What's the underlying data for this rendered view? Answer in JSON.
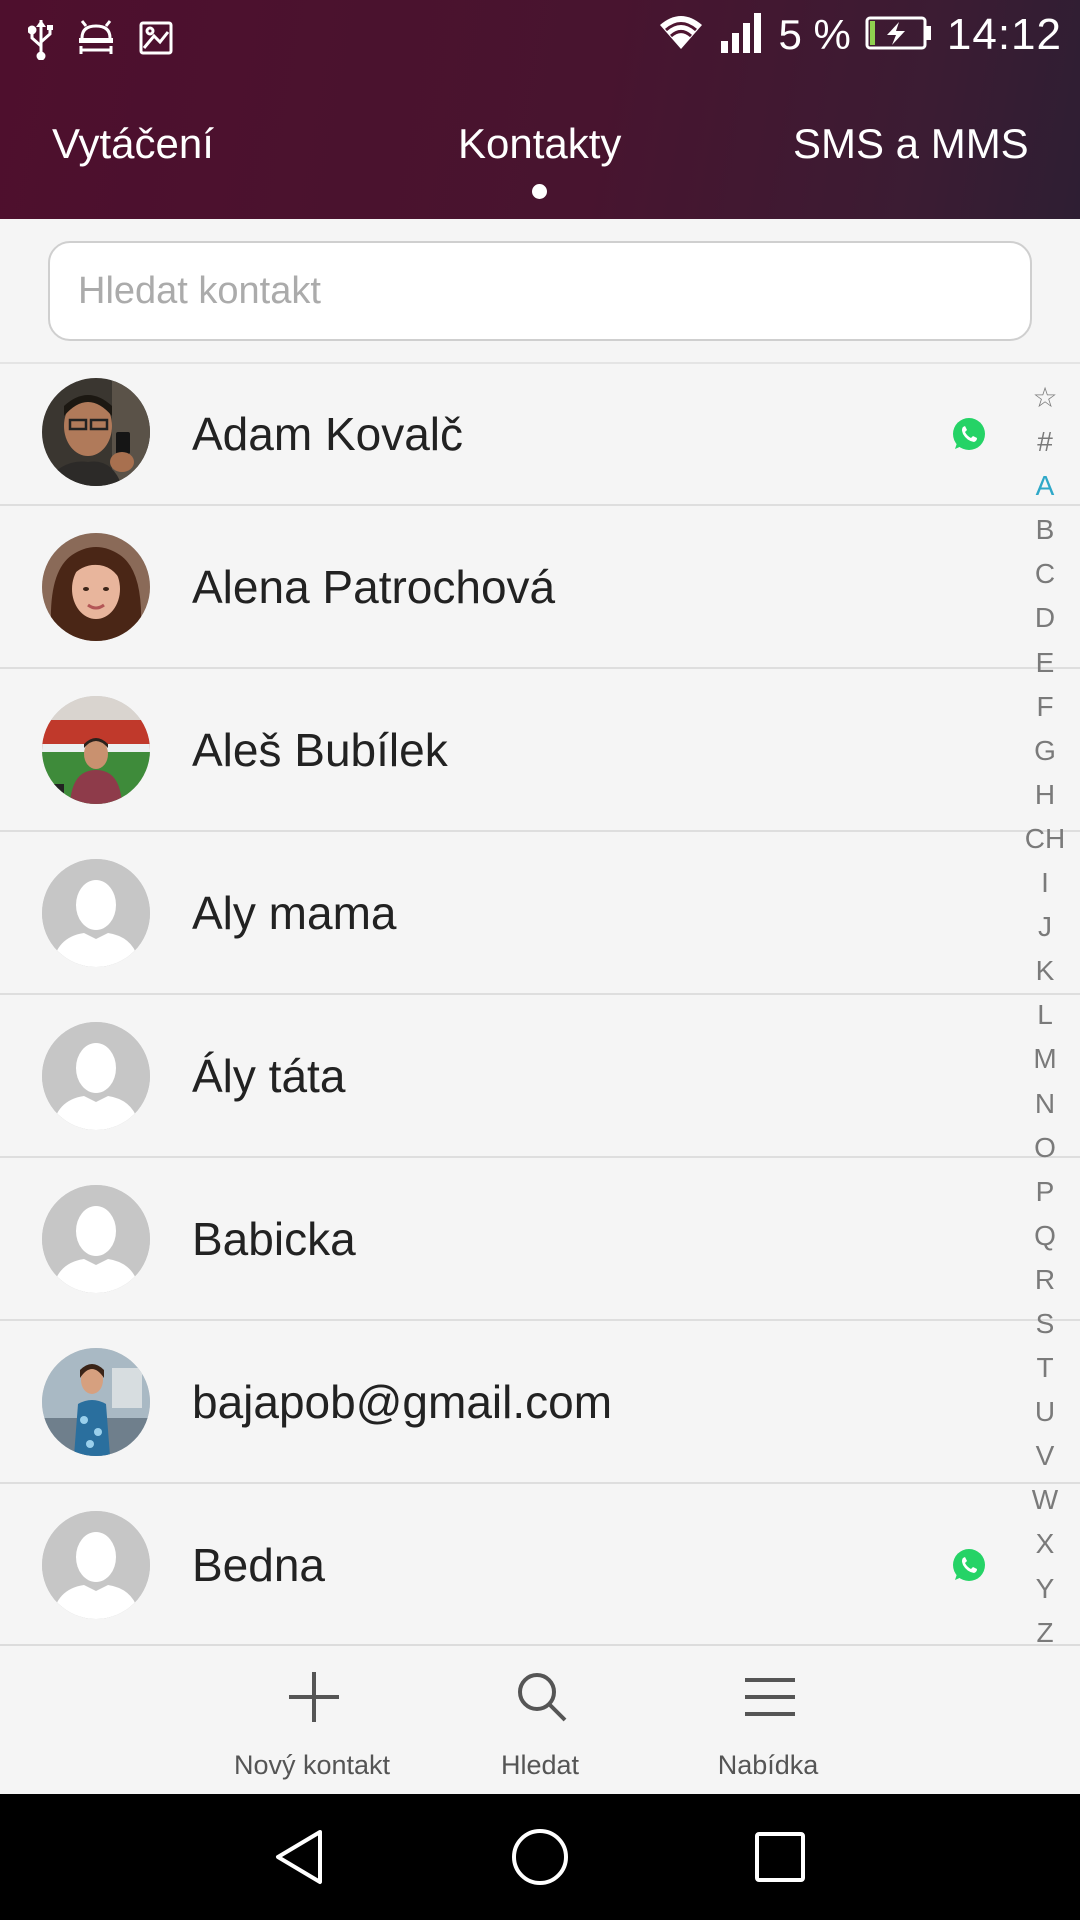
{
  "status_bar": {
    "battery_percent": "5 %",
    "time": "14:12",
    "icons": [
      "usb-icon",
      "android-debug-icon",
      "image-notification-icon",
      "wifi-icon",
      "signal-icon",
      "battery-charging-icon"
    ]
  },
  "tabs": {
    "dial": "Vytáčení",
    "contacts": "Kontakty",
    "sms": "SMS a MMS",
    "active": "contacts"
  },
  "search": {
    "placeholder": "Hledat kontakt",
    "value": ""
  },
  "contacts": [
    {
      "name": "Adam Kovalč",
      "photo": "photo",
      "whatsapp": true
    },
    {
      "name": "Alena Patrochová",
      "photo": "photo",
      "whatsapp": false
    },
    {
      "name": "Aleš Bubílek",
      "photo": "photo",
      "whatsapp": false
    },
    {
      "name": "Aly mama",
      "photo": "placeholder",
      "whatsapp": false
    },
    {
      "name": "Ály táta",
      "photo": "placeholder",
      "whatsapp": false
    },
    {
      "name": "Babicka",
      "photo": "placeholder",
      "whatsapp": false
    },
    {
      "name": "bajapob@gmail.com",
      "photo": "photo",
      "whatsapp": false
    },
    {
      "name": "Bedna",
      "photo": "placeholder",
      "whatsapp": true
    }
  ],
  "alphabet_index": [
    "☆",
    "#",
    "A",
    "B",
    "C",
    "D",
    "E",
    "F",
    "G",
    "H",
    "CH",
    "I",
    "J",
    "K",
    "L",
    "M",
    "N",
    "O",
    "P",
    "Q",
    "R",
    "S",
    "T",
    "U",
    "V",
    "W",
    "X",
    "Y",
    "Z"
  ],
  "alphabet_active": "A",
  "toolbar": {
    "new_contact": "Nový kontakt",
    "search": "Hledat",
    "menu": "Nabídka"
  },
  "colors": {
    "header": "#4e0f2d",
    "index_active": "#2fa8c8",
    "whatsapp": "#25d366"
  }
}
